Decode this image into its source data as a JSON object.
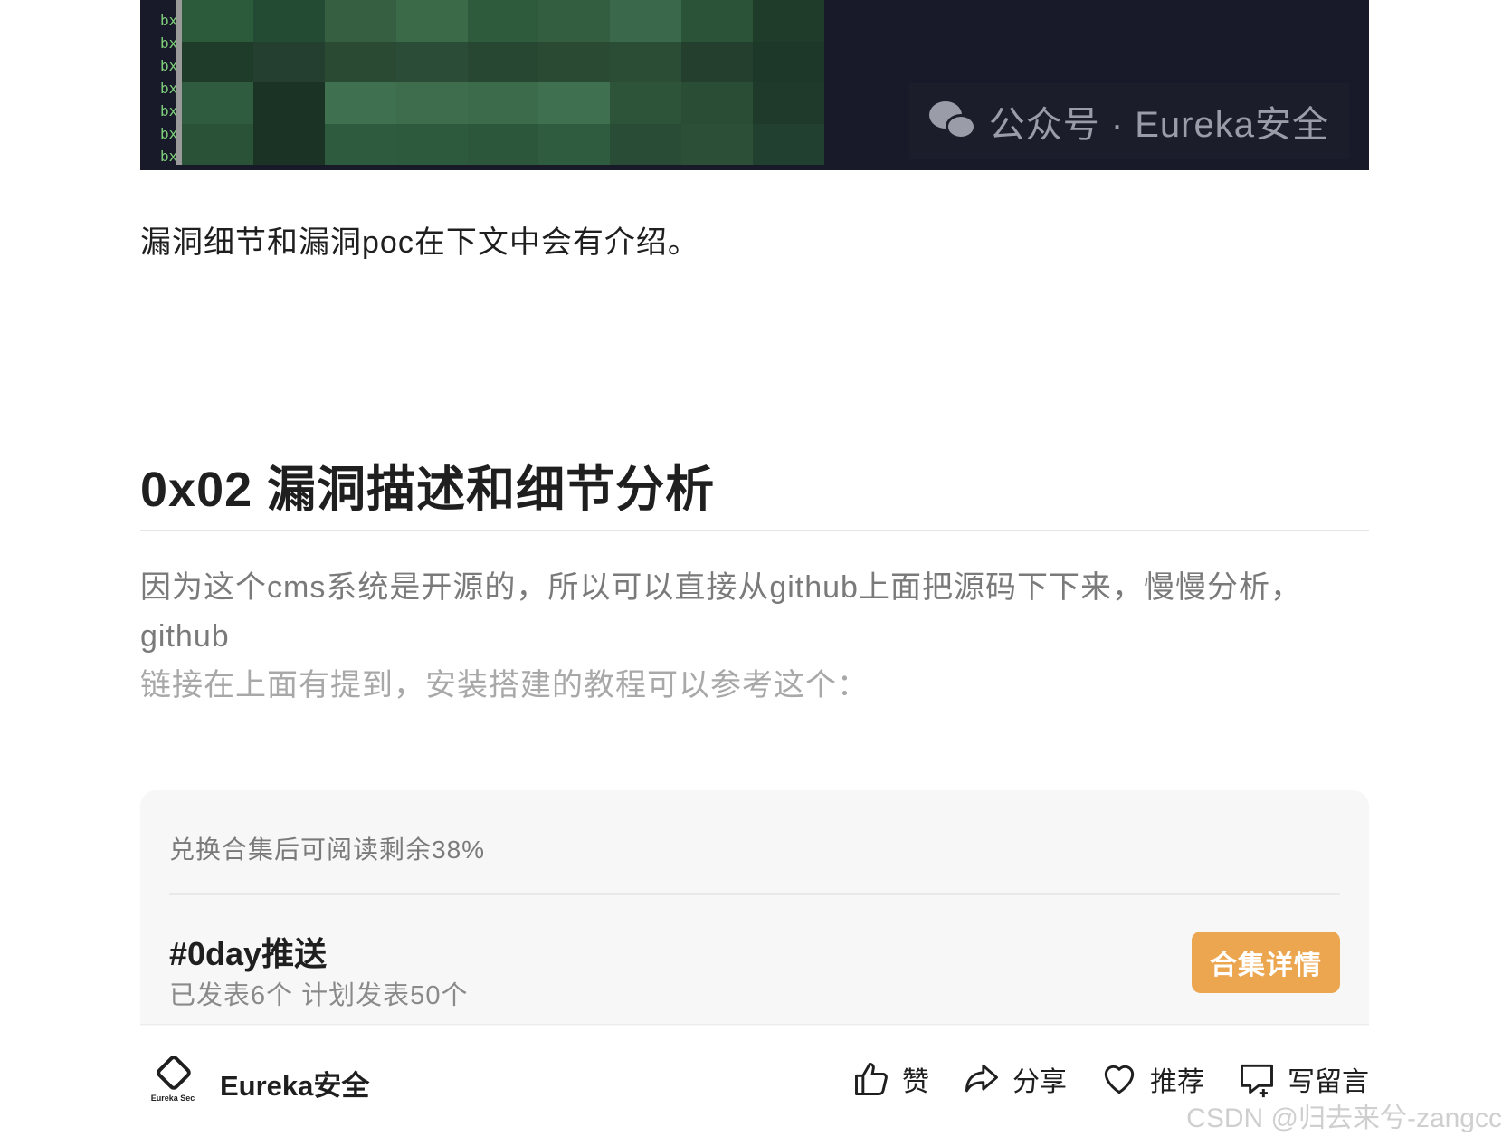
{
  "image": {
    "prefix_lines": [
      "bx",
      "bx",
      "bx",
      "bx",
      "bx",
      "bx",
      "bx"
    ],
    "watermark_text": "公众号 · Eureka安全",
    "mosaic_colors": [
      [
        "#2b5b3b",
        "#234b33",
        "#355f40",
        "#3a6a47",
        "#2f5b3d",
        "#335e3f",
        "#39684a",
        "#2a5337",
        "#1f3b2a"
      ],
      [
        "#1f3b2a",
        "#243f2f",
        "#2a4a34",
        "#2b4c36",
        "#284732",
        "#2a4a34",
        "#2b4c35",
        "#253f2e",
        "#1d3728"
      ],
      [
        "#2f5c3e",
        "#1b3324",
        "#3f7050",
        "#3d6d4c",
        "#3b6b4a",
        "#3f7050",
        "#2d5339",
        "#294d35",
        "#1f3a2a"
      ],
      [
        "#2a5237",
        "#1b3324",
        "#2e5a3d",
        "#2d5a3d",
        "#2c573b",
        "#2f5b3e",
        "#284c35",
        "#2b4f37",
        "#22402f"
      ]
    ]
  },
  "intro": "漏洞细节和漏洞poc在下文中会有介绍。",
  "section_title": "0x02 漏洞描述和细节分析",
  "paragraph": {
    "line1": "因为这个cms系统是开源的，所以可以直接从github上面把源码下下来，慢慢分析，github",
    "line2": "链接在上面有提到，安装搭建的教程可以参考这个："
  },
  "paywall": {
    "note": "兑换合集后可阅读剩余38%",
    "collection_title": "#0day推送",
    "collection_stats": "已发表6个  计划发表50个",
    "button": "合集详情",
    "button_color": "#eca64f"
  },
  "footer": {
    "logo_text": "Eureka Sec",
    "account_name": "Eureka安全",
    "actions": [
      {
        "icon": "thumbs-up-icon",
        "label": "赞"
      },
      {
        "icon": "share-icon",
        "label": "分享"
      },
      {
        "icon": "heart-icon",
        "label": "推荐"
      },
      {
        "icon": "comment-icon",
        "label": "写留言"
      }
    ]
  },
  "csdn_watermark": "CSDN @归去来兮-zangcc"
}
